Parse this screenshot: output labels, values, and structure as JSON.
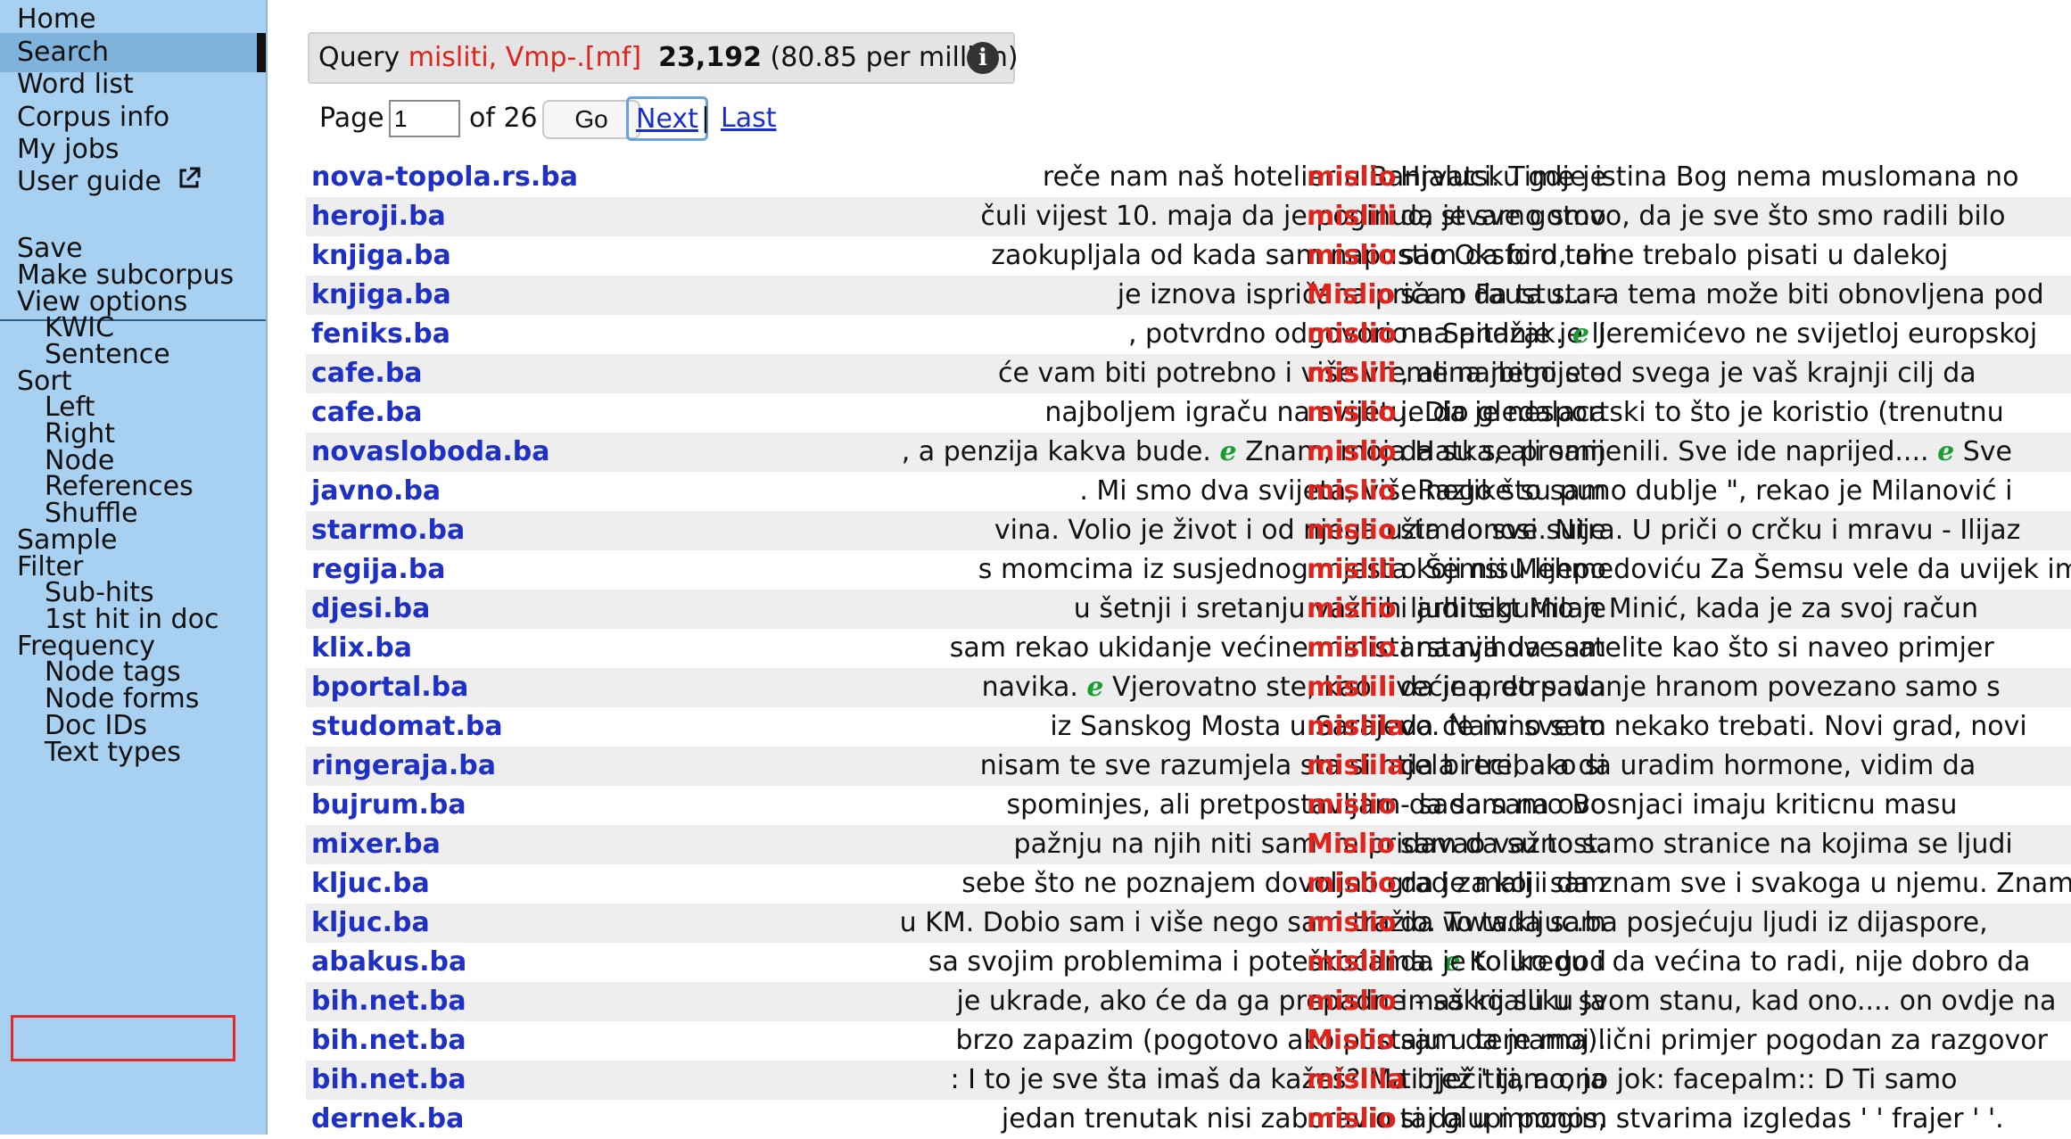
{
  "sidebar": {
    "items": [
      {
        "label": "Home",
        "active": false,
        "indent": false
      },
      {
        "label": "Search",
        "active": true,
        "indent": false
      },
      {
        "label": "Word list",
        "active": false,
        "indent": false
      },
      {
        "label": "Corpus info",
        "active": false,
        "indent": false
      },
      {
        "label": "My jobs",
        "active": false,
        "indent": false
      },
      {
        "label": "User guide",
        "active": false,
        "indent": false,
        "icon": "external-link-icon"
      }
    ],
    "items2": [
      {
        "label": "Save",
        "indent": false
      },
      {
        "label": "Make subcorpus",
        "indent": false
      },
      {
        "label": "View options",
        "indent": false
      },
      {
        "label": "KWIC",
        "indent": true
      },
      {
        "label": "Sentence",
        "indent": true
      },
      {
        "label": "Sort",
        "indent": false
      },
      {
        "label": "Left",
        "indent": true
      },
      {
        "label": "Right",
        "indent": true
      },
      {
        "label": "Node",
        "indent": true
      },
      {
        "label": "References",
        "indent": true
      },
      {
        "label": "Shuffle",
        "indent": true
      },
      {
        "label": "Sample",
        "indent": false
      },
      {
        "label": "Filter",
        "indent": false
      },
      {
        "label": "Sub-hits",
        "indent": true
      },
      {
        "label": "1st hit in doc",
        "indent": true
      },
      {
        "label": "Frequency",
        "indent": false
      },
      {
        "label": "Node tags",
        "indent": true
      },
      {
        "label": "Node forms",
        "indent": true,
        "highlighted": true
      },
      {
        "label": "Doc IDs",
        "indent": true
      },
      {
        "label": "Text types",
        "indent": true
      }
    ]
  },
  "query": {
    "label": "Query",
    "expression": "misliti, Vmp-.[mf]",
    "count": "23,192",
    "per_million": "(80.85 per million)",
    "info_icon": "info-icon"
  },
  "pager": {
    "page_label": "Page",
    "page_value": "1",
    "of_label": "of 26",
    "go_label": "Go",
    "next_label": "Next",
    "separator": "|",
    "last_label": "Last"
  },
  "colors": {
    "sidebar_bg": "#a8d0f0",
    "link": "#1f30c4",
    "node": "#e0241b",
    "paragraph_mark": "#1a9e34",
    "row_shade": "#eeeeee"
  },
  "concordance": [
    {
      "src": "nova-topola.rs.ba",
      "left": "reče nam naš hotelier u Banjaluci. Time je",
      "node": "mislio",
      "right": "Hrvatsku gdje istina Bog nema muslomana no"
    },
    {
      "src": "heroji.ba",
      "left": "čuli vijest 10. maja da je poginuo, stvarno smo",
      "node": "mislili",
      "right": "da je sve gotovo, da je sve što smo radili bilo"
    },
    {
      "src": "knjiga.ba",
      "left": "zaokupljala od kada sam napustio Oksford, ali",
      "node": "mislio",
      "right": "sam da bi o tome trebalo pisati u dalekoj"
    },
    {
      "src": "knjiga.ba",
      "left": "je iznova ispričana priča o Faustu... -",
      "node": "Mislio",
      "right": "sa m da ta stara tema može biti obnovljena pod"
    },
    {
      "src": "feniks.ba",
      "left": ", potvrdno odgovorio na pitanje je li",
      "node": "mislio",
      "right": "na Sandžak. ¶ Jeremićevo ne svijetloj europskoj"
    },
    {
      "src": "cafe.ba",
      "left": "će vam biti potrebno i više vremena nego ste",
      "node": "mislili",
      "right": ", ali najbitnije od svega je vaš krajnji cilj da"
    },
    {
      "src": "cafe.ba",
      "left": "najboljem igraču na svijetu. Dio gledalaca",
      "node": "mislio",
      "right": "je da je nesportski to što je koristio (trenutnu"
    },
    {
      "src": "novasloboda.ba",
      "left": ", a penzija kakva bude. ¶ Znam, moja Hatka, ali sam",
      "node": "mislio",
      "right": "da su se promijenili. Sve ide naprijed.... ¶ Sve"
    },
    {
      "src": "javno.ba",
      "left": ". Mi smo dva svijeta, više nego što sam",
      "node": "mislio",
      "right": ". Razlike su puno dublje \", rekao je Milanović i"
    },
    {
      "src": "starmo.ba",
      "left": "vina. Volio je život i od njega uzimao sve. Nije",
      "node": "mislio",
      "right": "šta donosi sutra. U priči o crčku i mravu - Ilijaz"
    },
    {
      "src": "regija.ba",
      "left": "s momcima iz susjednog mjesta koji nisu lijepo",
      "node": "mislili",
      "right": "o Šemsi Mehmedoviću Za Šemsu vele da uvijek ima"
    },
    {
      "src": "djesi.ba",
      "left": "u šetnji i sretanju važnih ljudi sigurno je",
      "node": "mislio",
      "right": "i arhitekt Milan Minić, kada je za svoj račun"
    },
    {
      "src": "klix.ba",
      "left": "sam rekao ukidanje većine ministarstava da sam",
      "node": "mislio",
      "right": "i na njihove satelite kao što si naveo primjer"
    },
    {
      "src": "bportal.ba",
      "left": "navika. ¶ Vjerovatno ste, kao i većina, do sada",
      "node": "mislili",
      "right": "da je pretrpavanje hranom povezano samo s"
    },
    {
      "src": "studomat.ba",
      "left": "iz Sanskog Mosta u Sarajevo. Naivno sam",
      "node": "mislila",
      "right": "da će mi sve to nekako trebati. Novi grad, novi"
    },
    {
      "src": "ringeraja.ba",
      "left": "nisam te sve razumjela sta si htjela reci, ako si",
      "node": "mislila",
      "right": "da bi trebala da uradim hormone, vidim da"
    },
    {
      "src": "bujrum.ba",
      "left": "spominjes, ali pretpostavljam da sam na ovo",
      "node": "mislio",
      "right": "- sada samo Bosnjaci imaju kriticnu masu"
    },
    {
      "src": "mixer.ba",
      "left": "pažnju na njih niti sam im pridavao važnost.",
      "node": "Mislio",
      "right": "sam da su to samo stranice na kojima se ljudi"
    },
    {
      "src": "kljuc.ba",
      "left": "sebe što ne poznajem dovoljno grad za koji sam",
      "node": "mislio",
      "right": "da je mali i da znam sve i svakoga u njemu. Znam da"
    },
    {
      "src": "kljuc.ba",
      "left": "u KM. Dobio sam i više nego sam tražio. To tada sam",
      "node": "mislio",
      "right": "da www.kljuc.ba posjećuju ljudi iz dijaspore,"
    },
    {
      "src": "abakus.ba",
      "left": "sa svojim problemima i poteškoćama. ¶ Koliko god",
      "node": "mislili",
      "right": "da je to uredu i da većina to radi, nije dobro da"
    },
    {
      "src": "bih.net.ba",
      "left": "je ukrade, ako će da ga prepadne - sakrij sliku Ja",
      "node": "mislio",
      "right": "imaš koalu u svom stanu, kad ono.... on ovdje na"
    },
    {
      "src": "bih.net.ba",
      "left": "brzo zapazim (pogotovo ako postaju u temama).",
      "node": "Mislio",
      "right": "sam da je moj lični primjer pogodan za razgovor"
    },
    {
      "src": "bih.net.ba",
      "left": ": I to je sve šta imaš da kažeš? Ma bjež ' tamo, ja",
      "node": "mislila",
      "right": "ti rječitiji, a ono jok: facepalm:: D Ti samo"
    },
    {
      "src": "dernek.ba",
      "left": "jedan trenutak nisi zaboravio taj glupi ponos,",
      "node": "mislio",
      "right": "si da u mnogim stvarima izgledas ' ' frajer ' '."
    }
  ]
}
